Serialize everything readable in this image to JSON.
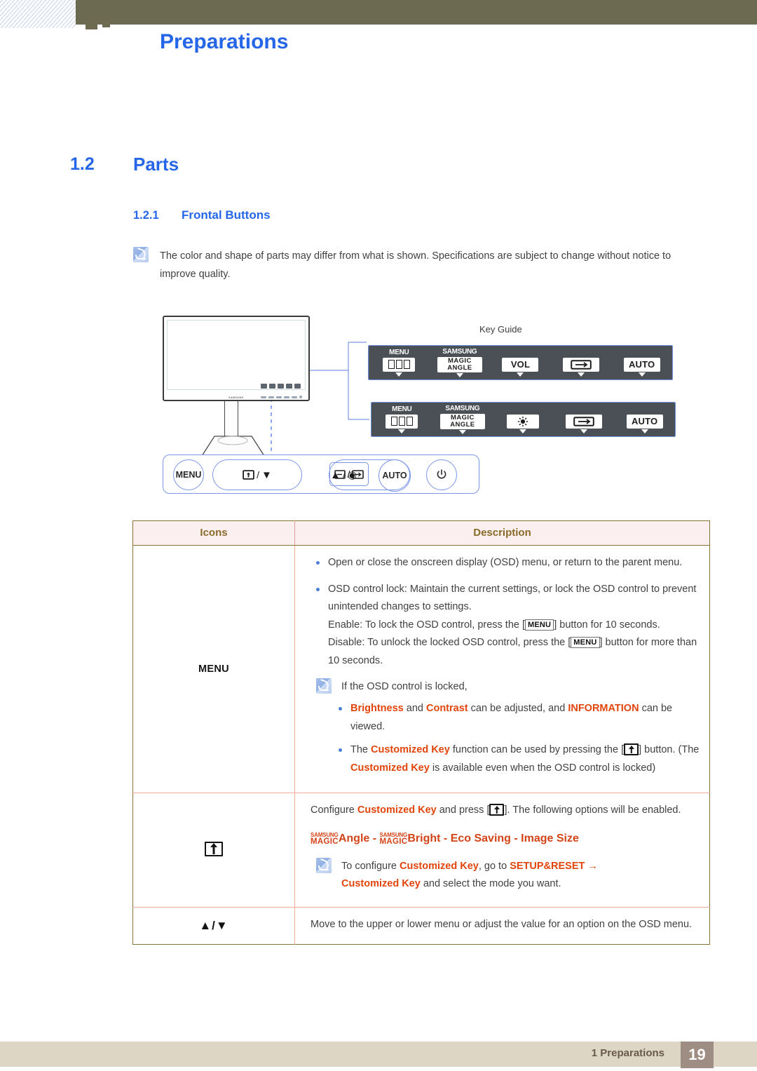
{
  "header": {
    "title": "Preparations"
  },
  "headings": {
    "section_number": "1.2",
    "section_title": "Parts",
    "subsection_number": "1.2.1",
    "subsection_title": "Frontal Buttons"
  },
  "top_note": {
    "icon": "note-icon",
    "text": "The color and shape of parts may differ from what is shown. Specifications are subject to change without notice to improve quality."
  },
  "diagram": {
    "key_guide_label": "Key Guide",
    "monitor_logo": "SAMSUNG",
    "key_guide_panels": [
      {
        "name": "key-guide-panel-vol",
        "items": [
          {
            "top": "MENU",
            "btn_type": "menu-glyph",
            "label": ""
          },
          {
            "top": "SAMSUNG",
            "btn_type": "magic",
            "label": "MAGIC",
            "label2": "ANGLE"
          },
          {
            "top": "",
            "btn_type": "text",
            "label": "VOL"
          },
          {
            "top": "",
            "btn_type": "source",
            "label": ""
          },
          {
            "top": "",
            "btn_type": "text",
            "label": "AUTO"
          }
        ]
      },
      {
        "name": "key-guide-panel-brightness",
        "items": [
          {
            "top": "MENU",
            "btn_type": "menu-glyph",
            "label": ""
          },
          {
            "top": "SAMSUNG",
            "btn_type": "magic",
            "label": "MAGIC",
            "label2": "ANGLE"
          },
          {
            "top": "",
            "btn_type": "brightness",
            "label": ""
          },
          {
            "top": "",
            "btn_type": "source",
            "label": ""
          },
          {
            "top": "",
            "btn_type": "text",
            "label": "AUTO"
          }
        ]
      }
    ],
    "control_bar": {
      "menu": "MENU",
      "custom_down": "/",
      "up_enter": "/",
      "source": "/",
      "auto": "AUTO",
      "power": "⏻"
    }
  },
  "table": {
    "columns": [
      "Icons",
      "Description"
    ],
    "rows": [
      {
        "icon_label": "MENU",
        "icon_type": "menu-text",
        "bullets": [
          "Open or close the onscreen display (OSD) menu, or return to the parent menu.",
          "OSD control lock: Maintain the current settings, or lock the OSD control to prevent unintended changes to settings."
        ],
        "enable_line_pre": "Enable: To lock the OSD control, press the [",
        "enable_key": "MENU",
        "enable_line_post": "] button for 10 seconds.",
        "disable_line_pre": "Disable: To unlock the locked OSD control, press the [",
        "disable_key": "MENU",
        "disable_line_post": "] button for more than 10 seconds.",
        "note_intro": "If the OSD control is locked,",
        "note_bullet1": {
          "p1": "Brightness",
          "p2": " and ",
          "p3": "Contrast",
          "p4": " can be adjusted, and ",
          "p5": "INFORMATION",
          "p6": " can be viewed."
        },
        "note_bullet2": {
          "p1": "The ",
          "p2": "Customized Key",
          "p3": " function can be used by pressing the [",
          "p4": "] button. (The ",
          "p5": "Customized Key",
          "p6": " is available even when the OSD control is locked)"
        }
      },
      {
        "icon_type": "customized-key",
        "icon_label": "",
        "line1_pre": "Configure ",
        "line1_key": "Customized Key",
        "line1_mid": " and press [",
        "line1_post": "]. The following options will be enabled.",
        "options": {
          "magic1_small": "SAMSUNG",
          "magic1_big": "MAGIC",
          "opt1": "Angle",
          "sep1": " - ",
          "magic2_small": "SAMSUNG",
          "magic2_big": "MAGIC",
          "opt2": "Bright",
          "sep2": " - ",
          "opt3": "Eco Saving",
          "sep3": " - ",
          "opt4": "Image Size"
        },
        "note": {
          "p1": "To configure ",
          "p2": "Customized Key",
          "p3": ", go to ",
          "p4": "SETUP&RESET",
          "p5": "  →  ",
          "p6": "Customized Key",
          "p7": " and select the mode you want."
        }
      },
      {
        "icon_type": "up-down",
        "icon_label": "▲/▼",
        "description": "Move to the upper or lower menu or adjust the value for an option on the OSD menu."
      }
    ]
  },
  "footer": {
    "chapter": "1 Preparations",
    "page_number": "19"
  },
  "colors": {
    "heading_blue": "#2566e8",
    "header_bar": "#6d6a52",
    "accent_orange": "#e2450c",
    "table_border": "#8a7434",
    "table_inner_border": "#f0a899",
    "table_header_bg": "#fbf0ef",
    "table_header_text": "#8a6a28",
    "footer_bar": "#ddd6c4",
    "footer_page_bg": "#9e8d82"
  }
}
